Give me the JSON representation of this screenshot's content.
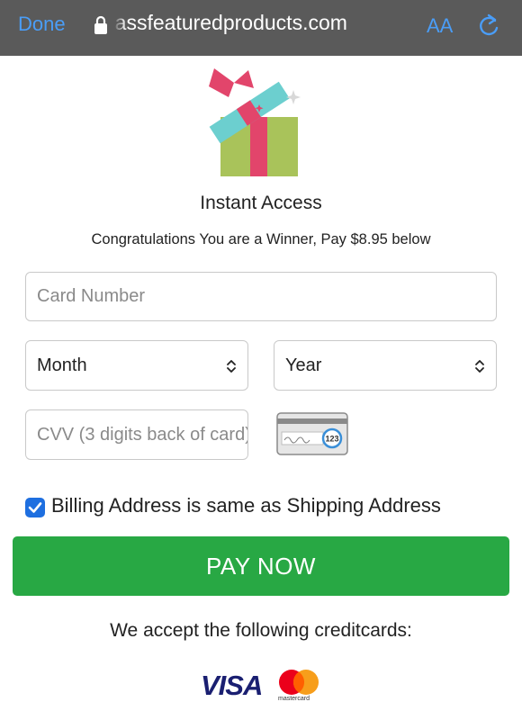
{
  "browser": {
    "done_label": "Done",
    "url": "firstclassfeaturedproducts.com",
    "text_size_label": "AA",
    "icons": {
      "lock": "lock-icon",
      "reload": "reload-icon"
    }
  },
  "hero": {
    "icon": "gift-icon",
    "title": "Instant Access",
    "subtitle": "Congratulations You are a Winner, Pay $8.95 below"
  },
  "form": {
    "card_number_placeholder": "Card Number",
    "month_selected": "Month",
    "year_selected": "Year",
    "cvv_placeholder": "CVV (3 digits back of card)",
    "cvv_help_icon": "card-signature-icon",
    "cvv_help_text": "123",
    "billing_same": true,
    "billing_same_label": "Billing Address is same as Shipping Address",
    "pay_button_label": "PAY NOW"
  },
  "payment_methods": {
    "label": "We accept the following creditcards:",
    "visa": "VISA",
    "mastercard": "mastercard"
  },
  "colors": {
    "topbar": "#5a5a5a",
    "link_blue": "#4a9df7",
    "pay_green": "#28a844",
    "checkbox_blue": "#1e6fe0"
  }
}
